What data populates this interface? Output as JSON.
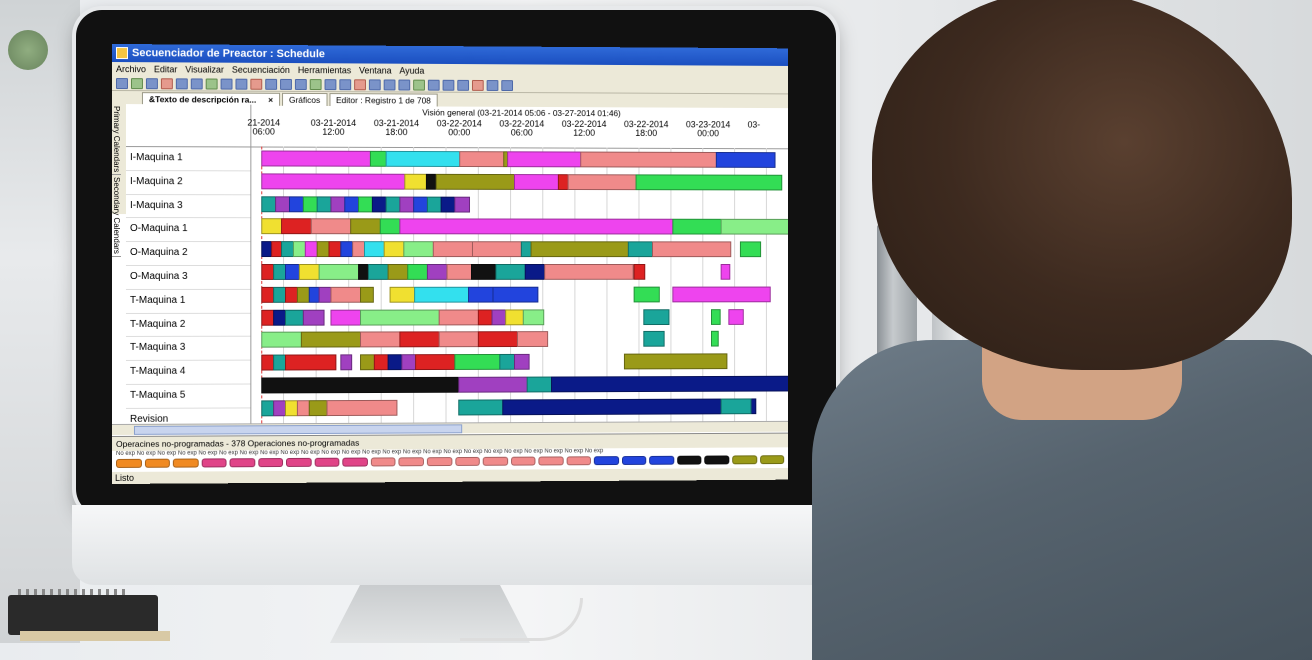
{
  "window": {
    "title": "Secuenciador de Preactor : Schedule"
  },
  "menu": [
    "Archivo",
    "Editar",
    "Visualizar",
    "Secuenciación",
    "Herramientas",
    "Ventana",
    "Ayuda"
  ],
  "tabs": [
    {
      "label": "&Texto de descripción ra...",
      "active": true,
      "close": "×"
    },
    {
      "label": "Gráficos",
      "active": false
    },
    {
      "label": "Editor : Registro 1 de 708",
      "active": false
    }
  ],
  "side_tabs": [
    "Primary Calendars",
    "Secondary Calendars"
  ],
  "timeline": {
    "header": "Visión general  (03-21-2014 05:06 - 03-27-2014 01:46)",
    "ticks": [
      {
        "date": "21-2014",
        "time": "06:00"
      },
      {
        "date": "03-21-2014",
        "time": "12:00"
      },
      {
        "date": "03-21-2014",
        "time": "18:00"
      },
      {
        "date": "03-22-2014",
        "time": "00:00"
      },
      {
        "date": "03-22-2014",
        "time": "06:00"
      },
      {
        "date": "03-22-2014",
        "time": "12:00"
      },
      {
        "date": "03-22-2014",
        "time": "18:00"
      },
      {
        "date": "03-23-2014",
        "time": "00:00"
      },
      {
        "date": "03-",
        "time": ""
      }
    ]
  },
  "resources": [
    "I-Maquina 1",
    "I-Maquina 2",
    "I-Maquina 3",
    "O-Maquina 1",
    "O-Maquina 2",
    "O-Maquina 3",
    "T-Maquina 1",
    "T-Maquina 2",
    "T-Maquina 3",
    "T-Maquina 4",
    "T-Maquina 5",
    "Revision"
  ],
  "colors": {
    "magenta": "#ee44ee",
    "pink": "#f08a8a",
    "cyan": "#33e0ee",
    "green": "#33dd55",
    "olive": "#9a9a18",
    "navy": "#0a1a88",
    "red": "#dd2222",
    "teal": "#1aa59a",
    "black": "#111111",
    "blue": "#2244dd",
    "yellow": "#f0e030",
    "lightgreen": "#88ee88",
    "purple": "#a040c0",
    "orange": "#f08a22"
  },
  "unscheduled": {
    "label": "Operacines  no-programadas  -  378  Operaciones  no-programadas",
    "chip_text": "No  exp No  exp No  exp No  exp No  exp No  exp No  exp No  exp No  exp No  exp No  exp No  exp No  exp No  exp No  exp No  exp No  exp No  exp No  exp No  exp No  exp No  exp No  exp No  exp",
    "chips": [
      "#f08a22",
      "#f08a22",
      "#f08a22",
      "#e04488",
      "#e04488",
      "#e04488",
      "#e04488",
      "#e04488",
      "#e04488",
      "#f08a8a",
      "#f08a8a",
      "#f08a8a",
      "#f08a8a",
      "#f08a8a",
      "#f08a8a",
      "#f08a8a",
      "#f08a8a",
      "#2244dd",
      "#2244dd",
      "#2244dd",
      "#111111",
      "#111111",
      "#9a9a18",
      "#9a9a18"
    ]
  },
  "status": "Listo"
}
